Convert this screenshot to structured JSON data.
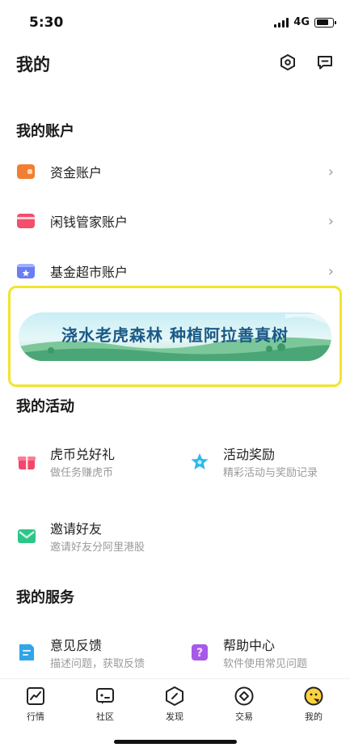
{
  "status_bar": {
    "time": "5:30",
    "network": "4G"
  },
  "header": {
    "title": "我的",
    "settings_icon": "hexagon-settings-icon",
    "message_icon": "message-icon"
  },
  "accounts": {
    "section_title": "我的账户",
    "items": [
      {
        "label": "资金账户",
        "icon": "fund-account-icon",
        "color": "#f07a2f"
      },
      {
        "label": "闲钱管家账户",
        "icon": "wallet-icon",
        "color": "#f04f6a"
      },
      {
        "label": "基金超市账户",
        "icon": "fund-market-icon",
        "color": "#6b7cf0"
      }
    ]
  },
  "banner": {
    "text": "浇水老虎森林 种植阿拉善真树"
  },
  "activities": {
    "section_title": "我的活动",
    "items": [
      {
        "title": "虎币兑好礼",
        "subtitle": "做任务赚虎币",
        "icon": "gift-icon",
        "color": "#f0476a"
      },
      {
        "title": "活动奖励",
        "subtitle": "精彩活动与奖励记录",
        "icon": "star-icon",
        "color": "#2fb8e8"
      },
      {
        "title": "邀请好友",
        "subtitle": "邀请好友分阿里港股",
        "icon": "mail-icon",
        "color": "#2ec48a"
      }
    ]
  },
  "services": {
    "section_title": "我的服务",
    "items": [
      {
        "title": "意见反馈",
        "subtitle": "描述问题，获取反馈",
        "icon": "feedback-icon",
        "color": "#2fa6e8"
      },
      {
        "title": "帮助中心",
        "subtitle": "软件使用常见问题",
        "icon": "help-icon",
        "color": "#a65ae8"
      }
    ]
  },
  "bottom_nav": [
    {
      "label": "行情",
      "icon": "market-chart-icon"
    },
    {
      "label": "社区",
      "icon": "community-icon"
    },
    {
      "label": "发现",
      "icon": "discover-icon"
    },
    {
      "label": "交易",
      "icon": "trade-icon"
    },
    {
      "label": "我的",
      "icon": "profile-icon"
    }
  ]
}
